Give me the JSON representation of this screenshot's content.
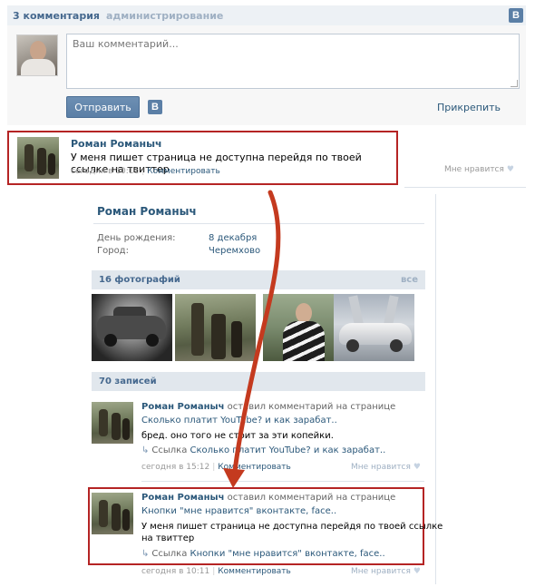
{
  "header": {
    "comments_count": "3 комментария",
    "admin_link": "администрирование",
    "vk_badge": "В"
  },
  "comment_form": {
    "placeholder": "Ваш комментарий...",
    "send_label": "Отправить",
    "vk_badge": "В",
    "attach_label": "Прикрепить"
  },
  "first_comment": {
    "author": "Роман Романыч",
    "text": "У меня пишет страница не доступна перейдя по твоей ссылке на твиттер",
    "date": "сегодня в 10:11",
    "separator": "|",
    "reply": "Комментировать",
    "like": "Мне нравится",
    "heart": "♥"
  },
  "profile": {
    "name": "Роман Романыч",
    "fields": [
      {
        "label": "День рождения:",
        "value": "8 декабря"
      },
      {
        "label": "Город:",
        "value": "Черемхово"
      }
    ],
    "photos_title": "16 фотографий",
    "photos_all": "все",
    "posts_title": "70 записей"
  },
  "posts": [
    {
      "author": "Роман Романыч",
      "action": "оставил комментарий на странице",
      "page_link": "Сколько платит YouTube? и как зарабат..",
      "text": "бред. оно того не стоит за эти копейки.",
      "share_icon": "↳",
      "share_label": "Ссылка",
      "share_link": "Сколько платит YouTube? и как зарабат..",
      "date": "сегодня в 15:12",
      "separator": "|",
      "reply": "Комментировать",
      "like": "Мне нравится",
      "heart": "♥"
    },
    {
      "author": "Роман Романыч",
      "action": "оставил комментарий на странице",
      "page_link": "Кнопки \"мне нравится\" вконтакте, face..",
      "text_line1": "У меня пишет страница не доступна перейдя по твоей ссылке",
      "text_line2": "на твиттер",
      "share_icon": "↳",
      "share_label": "Ссылка",
      "share_link": "Кнопки \"мне нравится\" вконтакте, face..",
      "date": "сегодня в 10:11",
      "separator": "|",
      "reply": "Комментировать",
      "like": "Мне нравится",
      "heart": "♥"
    }
  ],
  "colors": {
    "link": "#2b587a",
    "header_bg": "#edf1f5",
    "section_bg": "#e1e7ed",
    "highlight_border": "#b52424",
    "arrow": "#c43a1f"
  },
  "icons": [
    "vk-logo-icon",
    "heart-icon",
    "share-arrow-icon",
    "resize-grip-icon"
  ]
}
